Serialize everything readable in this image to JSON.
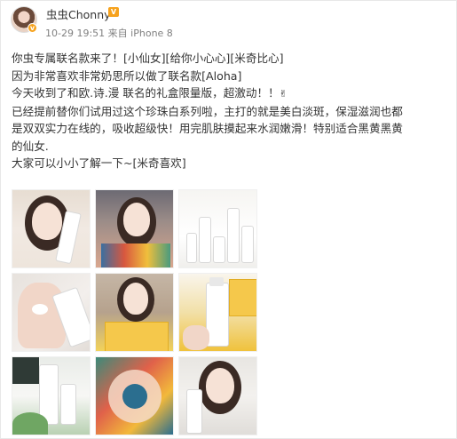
{
  "user": {
    "name": "虫虫Chonny",
    "vip_badge": "V",
    "avatar_badge": "v"
  },
  "meta": {
    "date": "10-29 19:51",
    "source_prefix": "来自",
    "device": "iPhone 8"
  },
  "post": {
    "lines": [
      "你虫专属联名款来了！[小仙女][给你小心心][米奇比心]",
      "因为非常喜欢非常奶思所以做了联名款[Aloha]",
      "今天收到了和欧.诗.漫 联名的礼盒限量版，超激动！！",
      "已经提前替你们试用过这个珍珠白系列啦，主打的就是美白淡斑，保湿滋润也都",
      "是双双实力在线的，吸收超级快！用完肌肤摸起来水润嫩滑！特别适合黑黄黑黄",
      "的仙女.",
      "大家可以小小了解一下~[米奇喜欢]"
    ],
    "peace_emoji": "✌"
  },
  "gallery": {
    "images": [
      {
        "name": "photo-1",
        "icon": "selfie-with-tube"
      },
      {
        "name": "photo-2",
        "icon": "selfie-with-giftbox"
      },
      {
        "name": "photo-3",
        "icon": "product-lineup"
      },
      {
        "name": "photo-4",
        "icon": "hand-swatch"
      },
      {
        "name": "photo-5",
        "icon": "selfie-with-box"
      },
      {
        "name": "photo-6",
        "icon": "bottle-in-hand"
      },
      {
        "name": "photo-7",
        "icon": "product-flatlay"
      },
      {
        "name": "photo-8",
        "icon": "colorful-packaging"
      },
      {
        "name": "photo-9",
        "icon": "selfie-with-bottle"
      }
    ]
  }
}
